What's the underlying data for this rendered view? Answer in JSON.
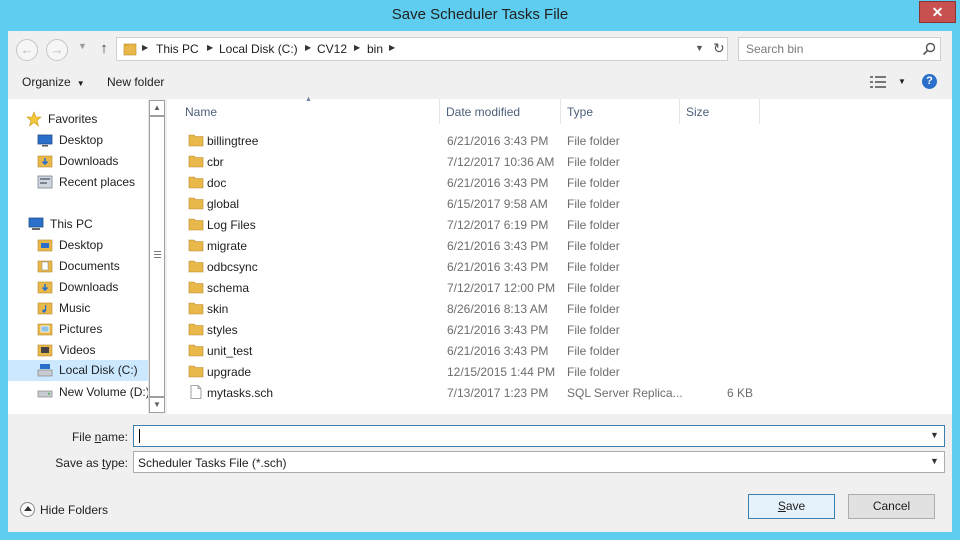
{
  "window": {
    "title": "Save Scheduler Tasks File",
    "close_glyph": "✕"
  },
  "address": {
    "crumbs": [
      "This PC",
      "Local Disk (C:)",
      "CV12",
      "bin"
    ]
  },
  "search": {
    "placeholder": "Search bin"
  },
  "toolbar": {
    "organize": "Organize",
    "new_folder": "New folder",
    "help": "?"
  },
  "nav": {
    "favorites_header": "Favorites",
    "favorites": [
      "Desktop",
      "Downloads",
      "Recent places"
    ],
    "thispc_header": "This PC",
    "thispc": [
      "Desktop",
      "Documents",
      "Downloads",
      "Music",
      "Pictures",
      "Videos",
      "Local Disk (C:)",
      "New Volume (D:)"
    ],
    "selected": "Local Disk (C:)"
  },
  "columns": {
    "name": "Name",
    "date": "Date modified",
    "type": "Type",
    "size": "Size"
  },
  "files": [
    {
      "name": "billingtree",
      "date": "6/21/2016 3:43 PM",
      "type": "File folder",
      "size": "",
      "kind": "folder"
    },
    {
      "name": "cbr",
      "date": "7/12/2017 10:36 AM",
      "type": "File folder",
      "size": "",
      "kind": "folder"
    },
    {
      "name": "doc",
      "date": "6/21/2016 3:43 PM",
      "type": "File folder",
      "size": "",
      "kind": "folder"
    },
    {
      "name": "global",
      "date": "6/15/2017 9:58 AM",
      "type": "File folder",
      "size": "",
      "kind": "folder"
    },
    {
      "name": "Log Files",
      "date": "7/12/2017 6:19 PM",
      "type": "File folder",
      "size": "",
      "kind": "folder"
    },
    {
      "name": "migrate",
      "date": "6/21/2016 3:43 PM",
      "type": "File folder",
      "size": "",
      "kind": "folder"
    },
    {
      "name": "odbcsync",
      "date": "6/21/2016 3:43 PM",
      "type": "File folder",
      "size": "",
      "kind": "folder"
    },
    {
      "name": "schema",
      "date": "7/12/2017 12:00 PM",
      "type": "File folder",
      "size": "",
      "kind": "folder"
    },
    {
      "name": "skin",
      "date": "8/26/2016 8:13 AM",
      "type": "File folder",
      "size": "",
      "kind": "folder"
    },
    {
      "name": "styles",
      "date": "6/21/2016 3:43 PM",
      "type": "File folder",
      "size": "",
      "kind": "folder"
    },
    {
      "name": "unit_test",
      "date": "6/21/2016 3:43 PM",
      "type": "File folder",
      "size": "",
      "kind": "folder"
    },
    {
      "name": "upgrade",
      "date": "12/15/2015 1:44 PM",
      "type": "File folder",
      "size": "",
      "kind": "folder"
    },
    {
      "name": "mytasks.sch",
      "date": "7/13/2017 1:23 PM",
      "type": "SQL Server Replica...",
      "size": "6 KB",
      "kind": "file"
    }
  ],
  "form": {
    "file_name_label_pre": "File ",
    "file_name_label_u": "n",
    "file_name_label_post": "ame:",
    "file_name_value": "",
    "save_type_label_pre": "Save as ",
    "save_type_label_u": "t",
    "save_type_label_post": "ype:",
    "save_type_value": "Scheduler Tasks File (*.sch)"
  },
  "footer": {
    "hide_folders": "Hide Folders",
    "save_u": "S",
    "save_rest": "ave",
    "cancel": "Cancel"
  },
  "colors": {
    "frame": "#5fcdef",
    "folder": "#e8b84a",
    "selected": "#cce8ff",
    "close": "#c75050"
  }
}
